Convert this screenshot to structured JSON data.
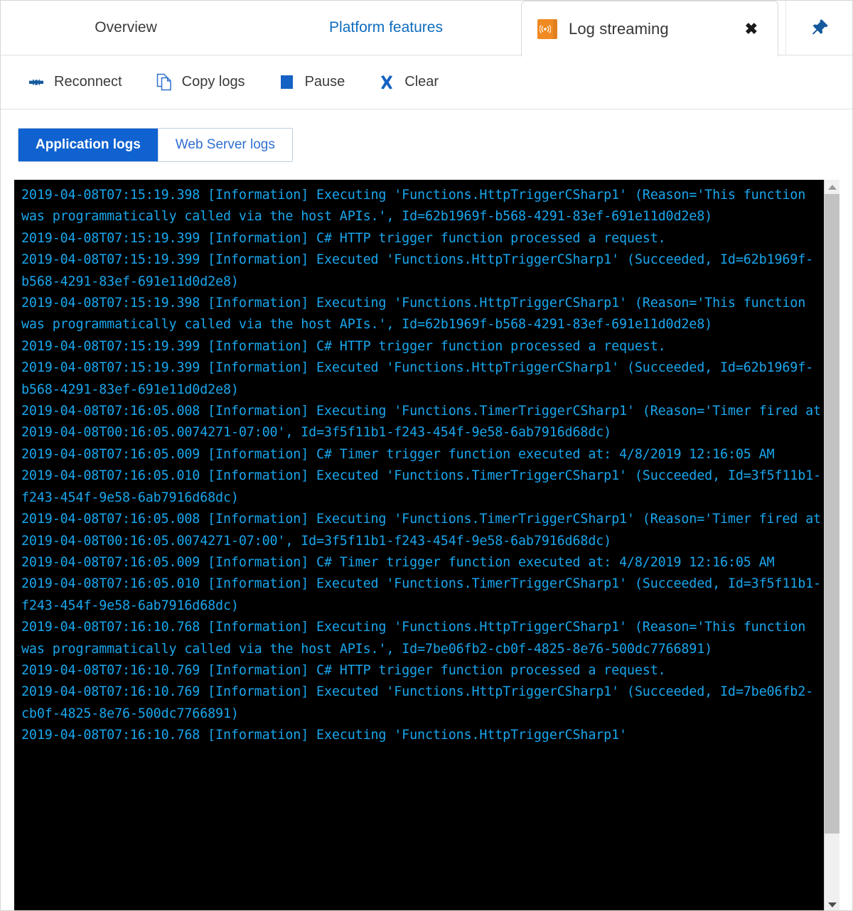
{
  "top_tabs": [
    {
      "label": "Overview",
      "style": "plain",
      "name": "overview"
    },
    {
      "label": "Platform features",
      "style": "link",
      "name": "platform-features"
    }
  ],
  "active_tab": {
    "label": "Log streaming",
    "icon": "log-streaming-icon",
    "close_label": "✖"
  },
  "pin": {
    "icon": "pin-icon"
  },
  "toolbar": {
    "reconnect_label": "Reconnect",
    "copy_logs_label": "Copy logs",
    "pause_label": "Pause",
    "clear_label": "Clear"
  },
  "pivot": {
    "application_logs": "Application logs",
    "web_server_logs": "Web Server logs",
    "selected": "Application logs"
  },
  "colors": {
    "accent_blue": "#0f62d0",
    "link_blue": "#0f6cbd",
    "log_text": "#19a6ec",
    "console_bg": "#000000",
    "tab_icon_orange": "#f08a22"
  },
  "console": {
    "lines": [
      "2019-04-08T07:15:19.398 [Information] Executing 'Functions.HttpTriggerCSharp1' (Reason='This function was programmatically called via the host APIs.', Id=62b1969f-b568-4291-83ef-691e11d0d2e8)",
      "2019-04-08T07:15:19.399 [Information] C# HTTP trigger function processed a request.",
      "2019-04-08T07:15:19.399 [Information] Executed 'Functions.HttpTriggerCSharp1' (Succeeded, Id=62b1969f-b568-4291-83ef-691e11d0d2e8)",
      "2019-04-08T07:15:19.398 [Information] Executing 'Functions.HttpTriggerCSharp1' (Reason='This function was programmatically called via the host APIs.', Id=62b1969f-b568-4291-83ef-691e11d0d2e8)",
      "2019-04-08T07:15:19.399 [Information] C# HTTP trigger function processed a request.",
      "2019-04-08T07:15:19.399 [Information] Executed 'Functions.HttpTriggerCSharp1' (Succeeded, Id=62b1969f-b568-4291-83ef-691e11d0d2e8)",
      "2019-04-08T07:16:05.008 [Information] Executing 'Functions.TimerTriggerCSharp1' (Reason='Timer fired at 2019-04-08T00:16:05.0074271-07:00', Id=3f5f11b1-f243-454f-9e58-6ab7916d68dc)",
      "2019-04-08T07:16:05.009 [Information] C# Timer trigger function executed at: 4/8/2019 12:16:05 AM",
      "2019-04-08T07:16:05.010 [Information] Executed 'Functions.TimerTriggerCSharp1' (Succeeded, Id=3f5f11b1-f243-454f-9e58-6ab7916d68dc)",
      "2019-04-08T07:16:05.008 [Information] Executing 'Functions.TimerTriggerCSharp1' (Reason='Timer fired at 2019-04-08T00:16:05.0074271-07:00', Id=3f5f11b1-f243-454f-9e58-6ab7916d68dc)",
      "2019-04-08T07:16:05.009 [Information] C# Timer trigger function executed at: 4/8/2019 12:16:05 AM",
      "2019-04-08T07:16:05.010 [Information] Executed 'Functions.TimerTriggerCSharp1' (Succeeded, Id=3f5f11b1-f243-454f-9e58-6ab7916d68dc)",
      "2019-04-08T07:16:10.768 [Information] Executing 'Functions.HttpTriggerCSharp1' (Reason='This function was programmatically called via the host APIs.', Id=7be06fb2-cb0f-4825-8e76-500dc7766891)",
      "2019-04-08T07:16:10.769 [Information] C# HTTP trigger function processed a request.",
      "2019-04-08T07:16:10.769 [Information] Executed 'Functions.HttpTriggerCSharp1' (Succeeded, Id=7be06fb2-cb0f-4825-8e76-500dc7766891)",
      "2019-04-08T07:16:10.768 [Information] Executing 'Functions.HttpTriggerCSharp1'"
    ]
  }
}
